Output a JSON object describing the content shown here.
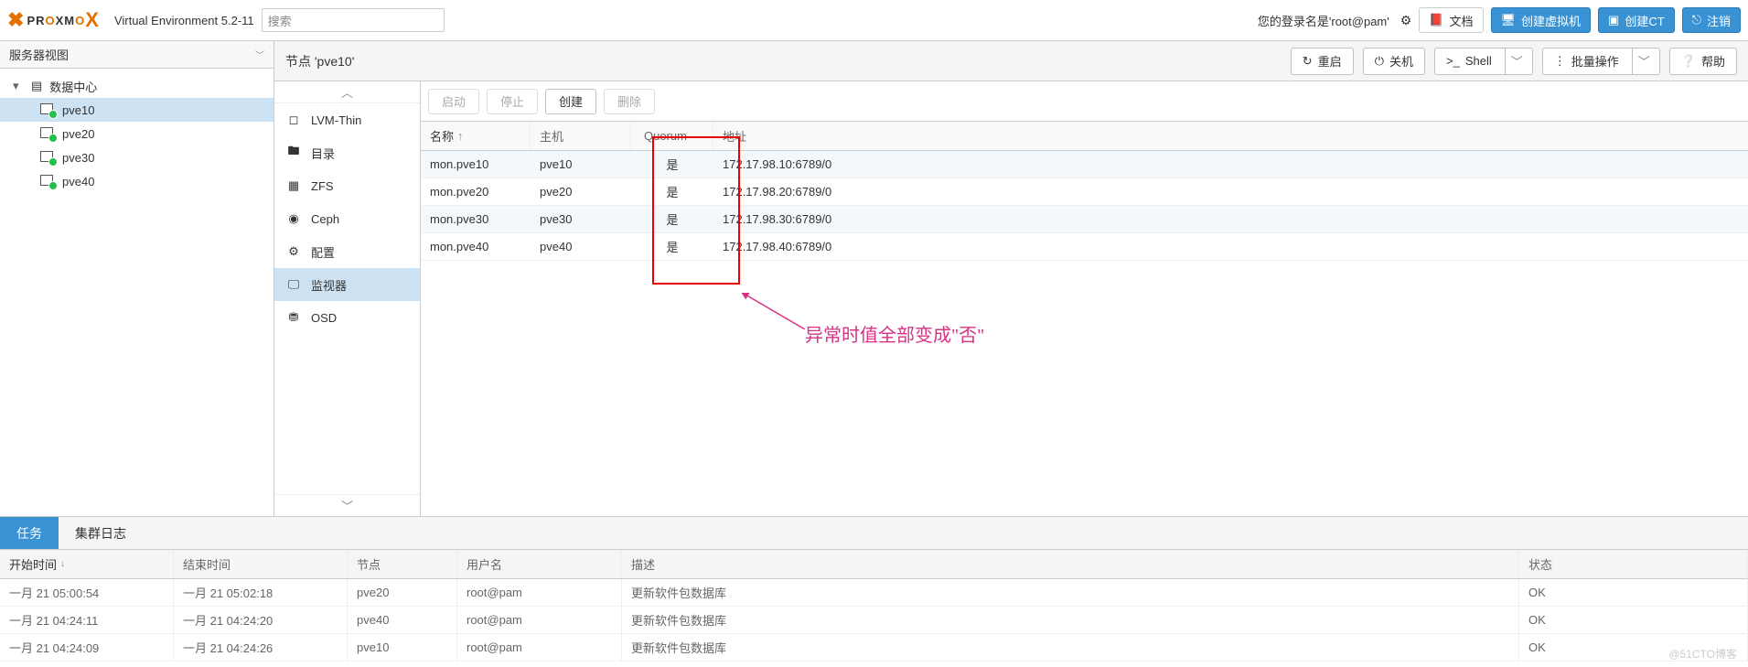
{
  "header": {
    "logo_pre": "PR",
    "logo_o": "O",
    "logo_post": "XM",
    "logo_o2": "O",
    "logo_x": "X",
    "version": "Virtual Environment 5.2-11",
    "search_placeholder": "搜索",
    "login_text": "您的登录名是'root@pam'",
    "docs": "文档",
    "create_vm": "创建虚拟机",
    "create_ct": "创建CT",
    "logout": "注销"
  },
  "tree": {
    "view": "服务器视图",
    "dc": "数据中心",
    "nodes": [
      "pve10",
      "pve20",
      "pve30",
      "pve40"
    ]
  },
  "node": {
    "title": "节点 'pve10'",
    "restart": "重启",
    "shutdown": "关机",
    "shell": "Shell",
    "bulk": "批量操作",
    "help": "帮助"
  },
  "subnav": {
    "lvm": "LVM-Thin",
    "dir": "目录",
    "zfs": "ZFS",
    "ceph": "Ceph",
    "config": "配置",
    "monitor": "监视器",
    "osd": "OSD"
  },
  "toolbar": {
    "start": "启动",
    "stop": "停止",
    "create": "创建",
    "delete": "删除"
  },
  "grid": {
    "cols": {
      "name": "名称",
      "host": "主机",
      "quorum": "Quorum",
      "addr": "地址"
    },
    "rows": [
      {
        "name": "mon.pve10",
        "host": "pve10",
        "q": "是",
        "addr": "172.17.98.10:6789/0"
      },
      {
        "name": "mon.pve20",
        "host": "pve20",
        "q": "是",
        "addr": "172.17.98.20:6789/0"
      },
      {
        "name": "mon.pve30",
        "host": "pve30",
        "q": "是",
        "addr": "172.17.98.30:6789/0"
      },
      {
        "name": "mon.pve40",
        "host": "pve40",
        "q": "是",
        "addr": "172.17.98.40:6789/0"
      }
    ]
  },
  "annotation": "异常时值全部变成\"否\"",
  "log": {
    "tabs": {
      "tasks": "任务",
      "cluster": "集群日志"
    },
    "cols": {
      "start": "开始时间",
      "end": "结束时间",
      "node": "节点",
      "user": "用户名",
      "desc": "描述",
      "stat": "状态"
    },
    "rows": [
      {
        "start": "一月 21 05:00:54",
        "end": "一月 21 05:02:18",
        "node": "pve20",
        "user": "root@pam",
        "desc": "更新软件包数据库",
        "stat": "OK"
      },
      {
        "start": "一月 21 04:24:11",
        "end": "一月 21 04:24:20",
        "node": "pve40",
        "user": "root@pam",
        "desc": "更新软件包数据库",
        "stat": "OK"
      },
      {
        "start": "一月 21 04:24:09",
        "end": "一月 21 04:24:26",
        "node": "pve10",
        "user": "root@pam",
        "desc": "更新软件包数据库",
        "stat": "OK"
      }
    ]
  },
  "watermark": "@51CTO博客"
}
